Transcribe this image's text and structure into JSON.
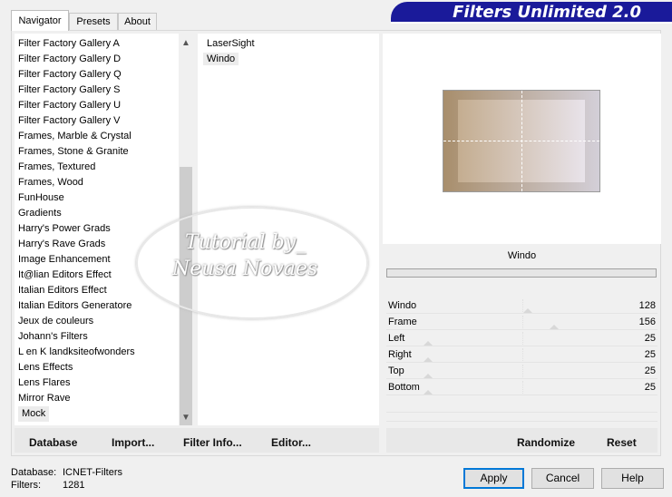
{
  "app": {
    "title": "Filters Unlimited 2.0"
  },
  "tabs": [
    {
      "label": "Navigator"
    },
    {
      "label": "Presets"
    },
    {
      "label": "About"
    }
  ],
  "categories": [
    "Filter Factory Gallery A",
    "Filter Factory Gallery D",
    "Filter Factory Gallery Q",
    "Filter Factory Gallery S",
    "Filter Factory Gallery U",
    "Filter Factory Gallery V",
    "Frames, Marble & Crystal",
    "Frames, Stone & Granite",
    "Frames, Textured",
    "Frames, Wood",
    "FunHouse",
    "Gradients",
    "Harry's Power Grads",
    "Harry's Rave Grads",
    "Image Enhancement",
    "It@lian Editors Effect",
    "Italian Editors Effect",
    "Italian Editors Generatore",
    "Jeux de couleurs",
    "Johann's Filters",
    "L en K landksiteofwonders",
    "Lens Effects",
    "Lens Flares",
    "Mirror Rave",
    "Mock"
  ],
  "selected_category": "Mock",
  "filters": [
    "LaserSight",
    "Windo"
  ],
  "selected_filter": "Windo",
  "watermark": {
    "line1": "Tutorial by_",
    "line2": "Neusa Novaes"
  },
  "preview": {
    "colors": {
      "left": "#a88e6c",
      "right": "#d3cfd8"
    }
  },
  "parameters": {
    "filter_name": "Windo",
    "items": [
      {
        "label": "Windo",
        "value": 128,
        "max": 255
      },
      {
        "label": "Frame",
        "value": 156,
        "max": 255
      },
      {
        "label": "Left",
        "value": 25,
        "max": 255
      },
      {
        "label": "Right",
        "value": 25,
        "max": 255
      },
      {
        "label": "Top",
        "value": 25,
        "max": 255
      },
      {
        "label": "Bottom",
        "value": 25,
        "max": 255
      }
    ]
  },
  "left_buttons": {
    "database": "Database",
    "import": "Import...",
    "filter_info": "Filter Info...",
    "editor": "Editor..."
  },
  "right_buttons": {
    "randomize": "Randomize",
    "reset": "Reset"
  },
  "status": {
    "database_label": "Database:",
    "database_value": "ICNET-Filters",
    "filters_label": "Filters:",
    "filters_value": "1281"
  },
  "dialog_buttons": {
    "apply": "Apply",
    "cancel": "Cancel",
    "help": "Help"
  },
  "colors": {
    "banner": "#1a1a9a",
    "focus": "#0078d7"
  }
}
